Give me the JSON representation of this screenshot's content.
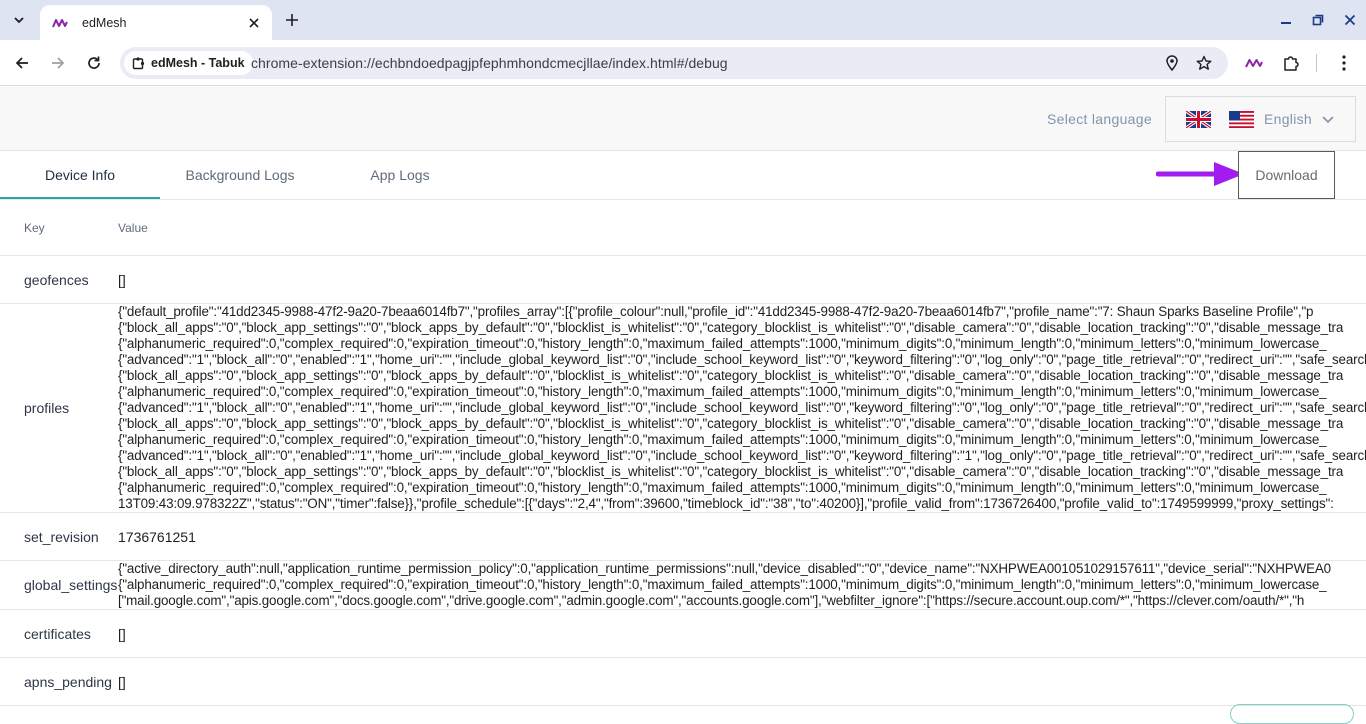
{
  "browser": {
    "tab_title": "edMesh",
    "site_chip": "edMesh - Tabuk",
    "url": "chrome-extension://echbndoedpagjpfephmhondcmecjllae/index.html#/debug",
    "accent": "#8e24aa"
  },
  "header": {
    "select_language_label": "Select language",
    "language_value": "English",
    "flags": [
      "uk-flag-icon",
      "us-flag-icon"
    ]
  },
  "tabs": [
    {
      "label": "Device Info",
      "active": true
    },
    {
      "label": "Background Logs",
      "active": false
    },
    {
      "label": "App Logs",
      "active": false
    }
  ],
  "download_label": "Download",
  "table": {
    "columns": [
      "Key",
      "Value"
    ],
    "rows": [
      {
        "key": "geofences",
        "value": "[]"
      },
      {
        "key": "profiles",
        "lines": [
          "{\"default_profile\":\"41dd2345-9988-47f2-9a20-7beaa6014fb7\",\"profiles_array\":[{\"profile_colour\":null,\"profile_id\":\"41dd2345-9988-47f2-9a20-7beaa6014fb7\",\"profile_name\":\"7: Shaun Sparks Baseline Profile\",\"p",
          "{\"block_all_apps\":\"0\",\"block_app_settings\":\"0\",\"block_apps_by_default\":\"0\",\"blocklist_is_whitelist\":\"0\",\"category_blocklist_is_whitelist\":\"0\",\"disable_camera\":\"0\",\"disable_location_tracking\":\"0\",\"disable_message_tra",
          "{\"alphanumeric_required\":0,\"complex_required\":0,\"expiration_timeout\":0,\"history_length\":0,\"maximum_failed_attempts\":1000,\"minimum_digits\":0,\"minimum_length\":0,\"minimum_letters\":0,\"minimum_lowercase_",
          "{\"advanced\":\"1\",\"block_all\":\"0\",\"enabled\":\"1\",\"home_uri\":\"\",\"include_global_keyword_list\":\"0\",\"include_school_keyword_list\":\"0\",\"keyword_filtering\":\"0\",\"log_only\":\"0\",\"page_title_retrieval\":\"0\",\"redirect_uri\":\"\",\"safe_search",
          "{\"block_all_apps\":\"0\",\"block_app_settings\":\"0\",\"block_apps_by_default\":\"0\",\"blocklist_is_whitelist\":\"0\",\"category_blocklist_is_whitelist\":\"0\",\"disable_camera\":\"0\",\"disable_location_tracking\":\"0\",\"disable_message_tra",
          "{\"alphanumeric_required\":0,\"complex_required\":0,\"expiration_timeout\":0,\"history_length\":0,\"maximum_failed_attempts\":1000,\"minimum_digits\":0,\"minimum_length\":0,\"minimum_letters\":0,\"minimum_lowercase_",
          "{\"advanced\":\"1\",\"block_all\":\"0\",\"enabled\":\"1\",\"home_uri\":\"\",\"include_global_keyword_list\":\"0\",\"include_school_keyword_list\":\"0\",\"keyword_filtering\":\"0\",\"log_only\":\"0\",\"page_title_retrieval\":\"0\",\"redirect_uri\":\"\",\"safe_search",
          "{\"block_all_apps\":\"0\",\"block_app_settings\":\"0\",\"block_apps_by_default\":\"0\",\"blocklist_is_whitelist\":\"0\",\"category_blocklist_is_whitelist\":\"0\",\"disable_camera\":\"0\",\"disable_location_tracking\":\"0\",\"disable_message_tra",
          "{\"alphanumeric_required\":0,\"complex_required\":0,\"expiration_timeout\":0,\"history_length\":0,\"maximum_failed_attempts\":1000,\"minimum_digits\":0,\"minimum_length\":0,\"minimum_letters\":0,\"minimum_lowercase_",
          "{\"advanced\":\"1\",\"block_all\":\"0\",\"enabled\":\"1\",\"home_uri\":\"\",\"include_global_keyword_list\":\"0\",\"include_school_keyword_list\":\"0\",\"keyword_filtering\":\"1\",\"log_only\":\"0\",\"page_title_retrieval\":\"0\",\"redirect_uri\":\"\",\"safe_search",
          "{\"block_all_apps\":\"0\",\"block_app_settings\":\"0\",\"block_apps_by_default\":\"0\",\"blocklist_is_whitelist\":\"0\",\"category_blocklist_is_whitelist\":\"0\",\"disable_camera\":\"0\",\"disable_location_tracking\":\"0\",\"disable_message_tra",
          "{\"alphanumeric_required\":0,\"complex_required\":0,\"expiration_timeout\":0,\"history_length\":0,\"maximum_failed_attempts\":1000,\"minimum_digits\":0,\"minimum_length\":0,\"minimum_letters\":0,\"minimum_lowercase_",
          "13T09:43:09.978322Z\",\"status\":\"ON\",\"timer\":false}},\"profile_schedule\":[{\"days\":\"2,4\",\"from\":39600,\"timeblock_id\":\"38\",\"to\":40200}],\"profile_valid_from\":1736726400,\"profile_valid_to\":1749599999,\"proxy_settings\":"
        ]
      },
      {
        "key": "set_revision",
        "value": "1736761251"
      },
      {
        "key": "global_settings",
        "lines": [
          "{\"active_directory_auth\":null,\"application_runtime_permission_policy\":0,\"application_runtime_permissions\":null,\"device_disabled\":\"0\",\"device_name\":\"NXHPWEA001051029157611\",\"device_serial\":\"NXHPWEA0",
          "{\"alphanumeric_required\":0,\"complex_required\":0,\"expiration_timeout\":0,\"history_length\":0,\"maximum_failed_attempts\":1000,\"minimum_digits\":0,\"minimum_length\":0,\"minimum_letters\":0,\"minimum_lowercase_",
          "[\"mail.google.com\",\"apis.google.com\",\"docs.google.com\",\"drive.google.com\",\"admin.google.com\",\"accounts.google.com\"],\"webfilter_ignore\":[\"https://secure.account.oup.com/*\",\"https://clever.com/oauth/*\",\"h"
        ]
      },
      {
        "key": "certificates",
        "value": "[]"
      },
      {
        "key": "apns_pending",
        "value": "[]"
      }
    ]
  }
}
